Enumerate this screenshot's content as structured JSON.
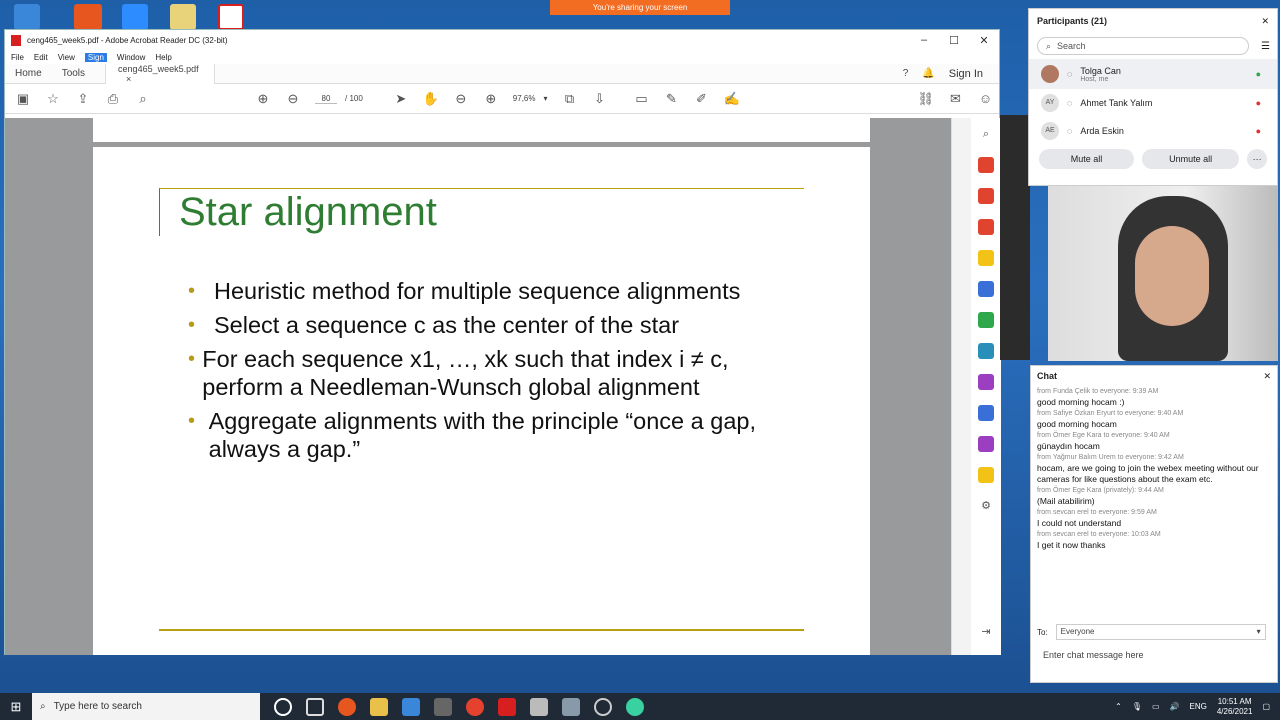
{
  "share_banner": "You're sharing your screen",
  "acrobat": {
    "title": "ceng465_week5.pdf - Adobe Acrobat Reader DC (32-bit)",
    "menu": [
      "File",
      "Edit",
      "View",
      "Sign",
      "Window",
      "Help"
    ],
    "tabs": {
      "home": "Home",
      "tools": "Tools",
      "doc": "ceng465_week5.pdf",
      "close": "×"
    },
    "sign_in": "Sign In",
    "page_current": "80",
    "page_total": "/ 100",
    "zoom": "97,6%"
  },
  "slide": {
    "title": "Star alignment",
    "bullets": [
      "Heuristic method for multiple sequence alignments",
      "Select a sequence c as the center of the star",
      "For each sequence x1, …, xk such that index i ≠ c, perform a Needleman-Wunsch global alignment",
      "Aggregate alignments with the principle “once a gap, always a gap.”"
    ]
  },
  "participants": {
    "header": "Participants (21)",
    "search_placeholder": "Search",
    "people": [
      {
        "initials": "",
        "name": "Tolga Can",
        "sub": "Host, me"
      },
      {
        "initials": "AY",
        "name": "Ahmet Tank Yalım",
        "sub": ""
      },
      {
        "initials": "AE",
        "name": "Arda Eskin",
        "sub": ""
      }
    ],
    "mute_all": "Mute all",
    "unmute_all": "Unmute all",
    "more": "···"
  },
  "chat": {
    "header": "Chat",
    "messages": [
      {
        "meta": "from Funda Çelik to everyone:   9:39 AM",
        "text": "good morning hocam :)"
      },
      {
        "meta": "from Safiye Özkan Eryurt to everyone:   9:40 AM",
        "text": "good morning hocam"
      },
      {
        "meta": "from Ömer Ege Kara to everyone:   9:40 AM",
        "text": "günaydın hocam"
      },
      {
        "meta": "from Yağmur Balım Urem to everyone:   9:42 AM",
        "text": "hocam, are we going to join the webex meeting without our cameras for like questions about the exam etc."
      },
      {
        "meta": "from Ömer Ege Kara (privately):   9:44 AM",
        "text": "(Mail atabilirim)"
      },
      {
        "meta": "from sevcan erel to everyone:   9:59 AM",
        "text": "I could not understand"
      },
      {
        "meta": "from sevcan erel to everyone:   10:03 AM",
        "text": "I get it now thanks"
      }
    ],
    "to_label": "To:",
    "to_value": "Everyone",
    "input_placeholder": "Enter chat message here"
  },
  "taskbar": {
    "search": "Type here to search",
    "lang": "ENG",
    "time": "10:51 AM",
    "date": "4/26/2021"
  }
}
